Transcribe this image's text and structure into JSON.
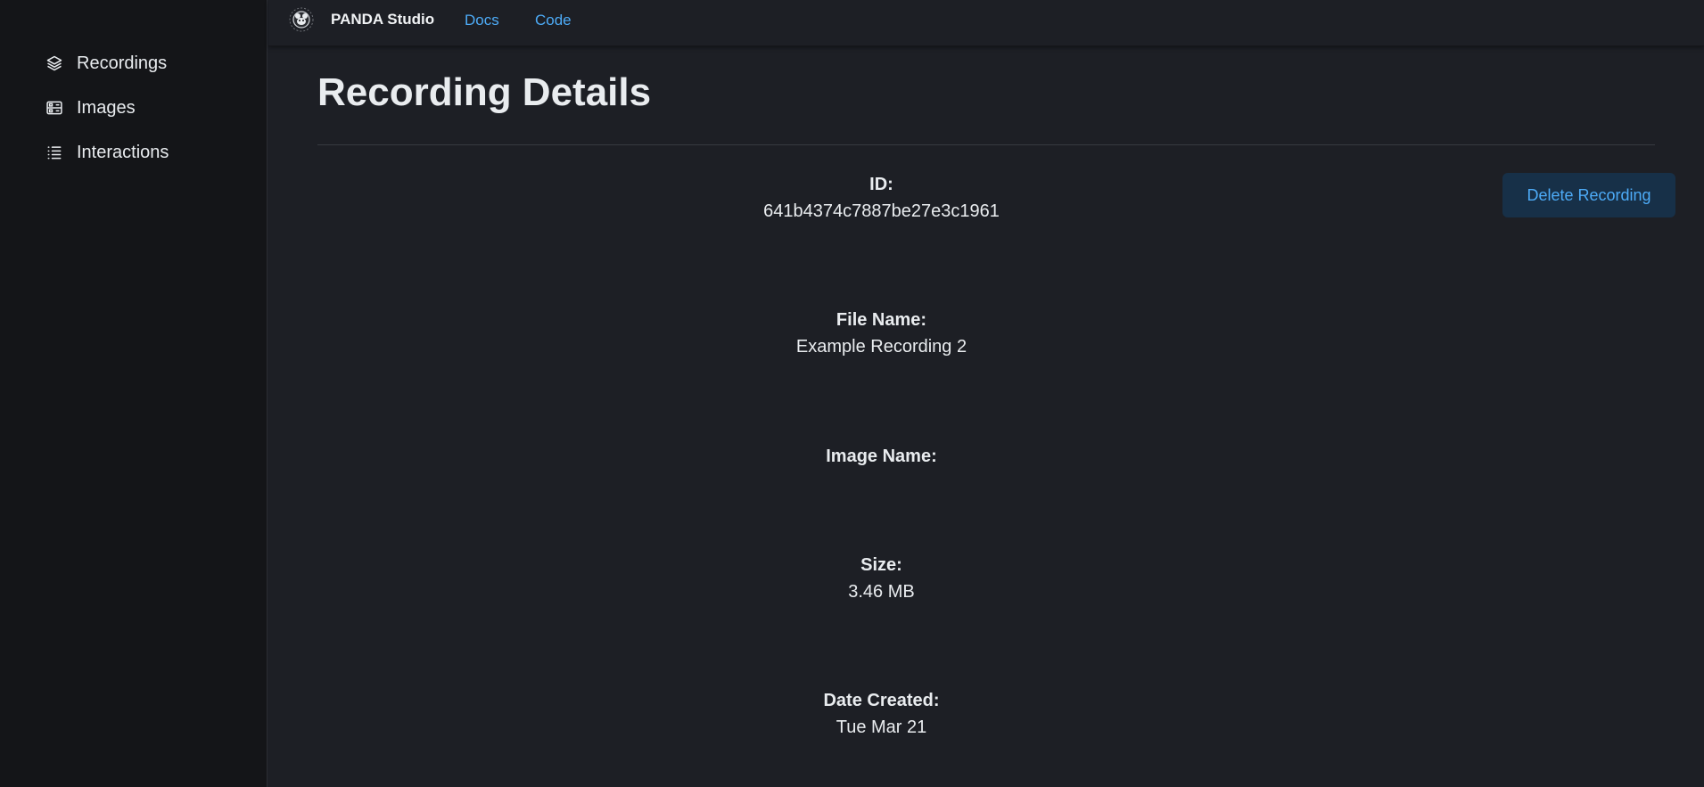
{
  "sidebar": {
    "items": [
      {
        "label": "Recordings",
        "icon": "layers-icon"
      },
      {
        "label": "Images",
        "icon": "server-icon"
      },
      {
        "label": "Interactions",
        "icon": "list-icon"
      }
    ]
  },
  "header": {
    "brand": "PANDA Studio",
    "links": [
      "Docs",
      "Code"
    ]
  },
  "main": {
    "title": "Recording Details",
    "delete_label": "Delete Recording",
    "fields": [
      {
        "label": "ID:",
        "value": "641b4374c7887be27e3c1961"
      },
      {
        "label": "File Name:",
        "value": "Example Recording 2"
      },
      {
        "label": "Image Name:",
        "value": ""
      },
      {
        "label": "Size:",
        "value": "3.46 MB"
      },
      {
        "label": "Date Created:",
        "value": "Tue Mar 21"
      }
    ]
  },
  "colors": {
    "background": "#1d1f25",
    "sidebar": "#141518",
    "accent": "#4dabf7",
    "button_bg": "#173048"
  }
}
